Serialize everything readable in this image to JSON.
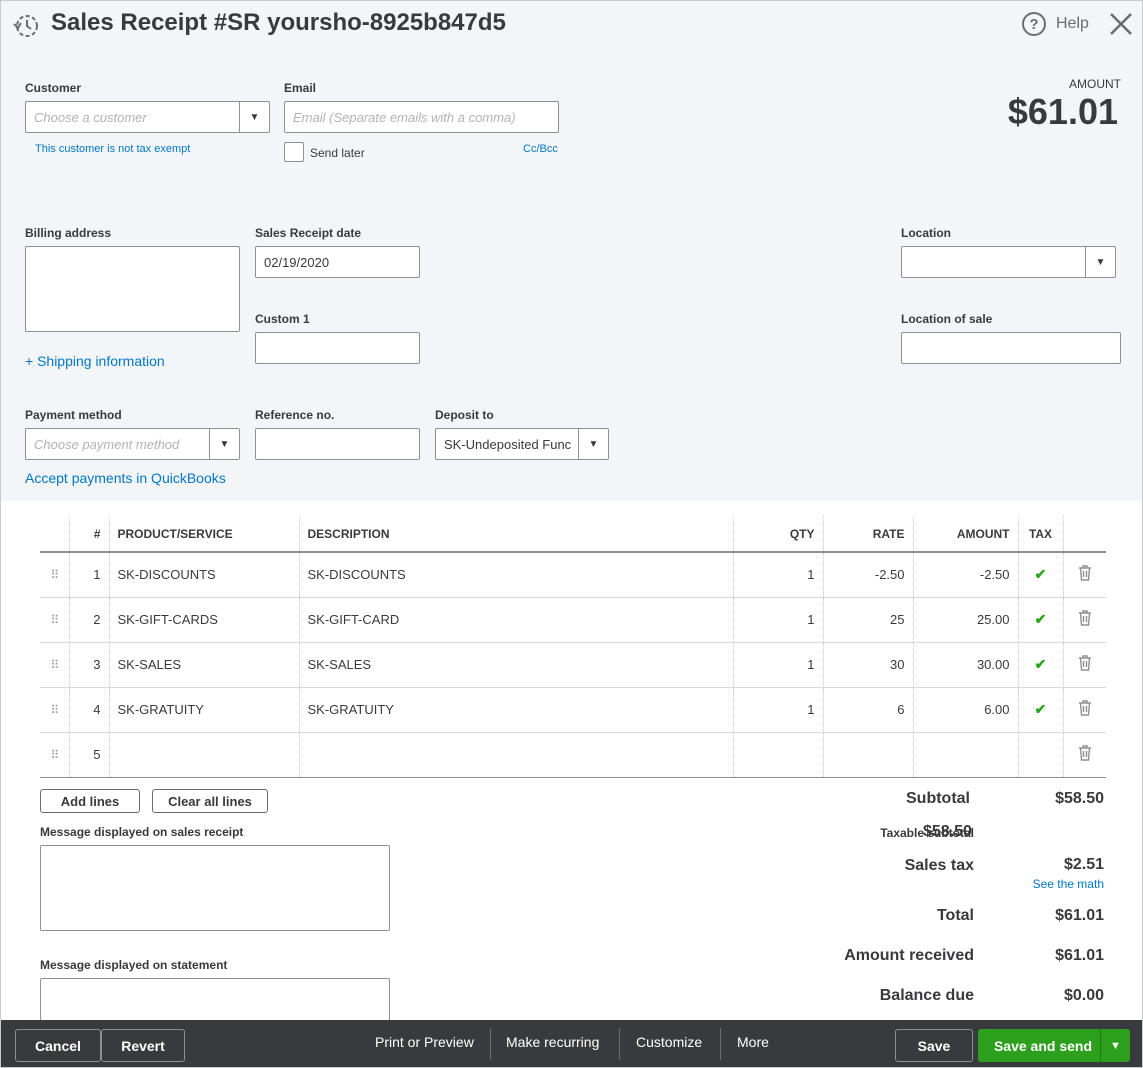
{
  "header": {
    "title": "Sales Receipt #SR yoursho-8925b847d5",
    "help_label": "Help"
  },
  "amount": {
    "label": "AMOUNT",
    "value": "$61.01"
  },
  "customer": {
    "label": "Customer",
    "placeholder": "Choose a customer",
    "tax_note": "This customer is not tax exempt"
  },
  "email": {
    "label": "Email",
    "placeholder": "Email (Separate emails with a comma)",
    "send_later_label": "Send later",
    "cc_bcc": "Cc/Bcc"
  },
  "billing": {
    "label": "Billing address",
    "shipping_link": "+ Shipping information"
  },
  "receipt_date": {
    "label": "Sales Receipt date",
    "value": "02/19/2020"
  },
  "custom1": {
    "label": "Custom 1"
  },
  "location": {
    "label": "Location"
  },
  "location_of_sale": {
    "label": "Location of sale"
  },
  "payment": {
    "label": "Payment method",
    "placeholder": "Choose payment method",
    "accept_link": "Accept payments in QuickBooks"
  },
  "reference": {
    "label": "Reference no."
  },
  "deposit": {
    "label": "Deposit to",
    "value": "SK-Undeposited Func"
  },
  "table": {
    "headers": [
      "#",
      "PRODUCT/SERVICE",
      "DESCRIPTION",
      "QTY",
      "RATE",
      "AMOUNT",
      "TAX"
    ],
    "rows": [
      {
        "num": "1",
        "product": "SK-DISCOUNTS",
        "description": "SK-DISCOUNTS",
        "qty": "1",
        "rate": "-2.50",
        "amount": "-2.50",
        "tax": "✔"
      },
      {
        "num": "2",
        "product": "SK-GIFT-CARDS",
        "description": "SK-GIFT-CARD",
        "qty": "1",
        "rate": "25",
        "amount": "25.00",
        "tax": "✔"
      },
      {
        "num": "3",
        "product": "SK-SALES",
        "description": "SK-SALES",
        "qty": "1",
        "rate": "30",
        "amount": "30.00",
        "tax": "✔"
      },
      {
        "num": "4",
        "product": "SK-GRATUITY",
        "description": "SK-GRATUITY",
        "qty": "1",
        "rate": "6",
        "amount": "6.00",
        "tax": "✔"
      },
      {
        "num": "5",
        "product": "",
        "description": "",
        "qty": "",
        "rate": "",
        "amount": "",
        "tax": ""
      }
    ]
  },
  "line_buttons": {
    "add": "Add lines",
    "clear": "Clear all lines"
  },
  "messages": {
    "receipt_label": "Message displayed on sales receipt",
    "statement_label": "Message displayed on statement"
  },
  "totals": {
    "subtotal_label": "Subtotal",
    "subtotal": "$58.50",
    "taxable_label": "Taxable subtotal",
    "taxable": "$58.50",
    "sales_tax_label": "Sales tax",
    "sales_tax": "$2.51",
    "see_math": "See the math",
    "total_label": "Total",
    "total": "$61.01",
    "received_label": "Amount received",
    "received": "$61.01",
    "balance_label": "Balance due",
    "balance": "$0.00"
  },
  "footer": {
    "cancel": "Cancel",
    "revert": "Revert",
    "print": "Print or Preview",
    "recurring": "Make recurring",
    "customize": "Customize",
    "more": "More",
    "save": "Save",
    "save_send": "Save and send"
  },
  "colors": {
    "accent_green": "#2ca01c",
    "link_blue": "#0077c5",
    "footer_bg": "#393a3d"
  },
  "icons": [
    "history-icon",
    "help-icon",
    "close-icon",
    "dropdown-arrow-icon",
    "drag-handle-icon",
    "check-icon",
    "trash-icon"
  ]
}
